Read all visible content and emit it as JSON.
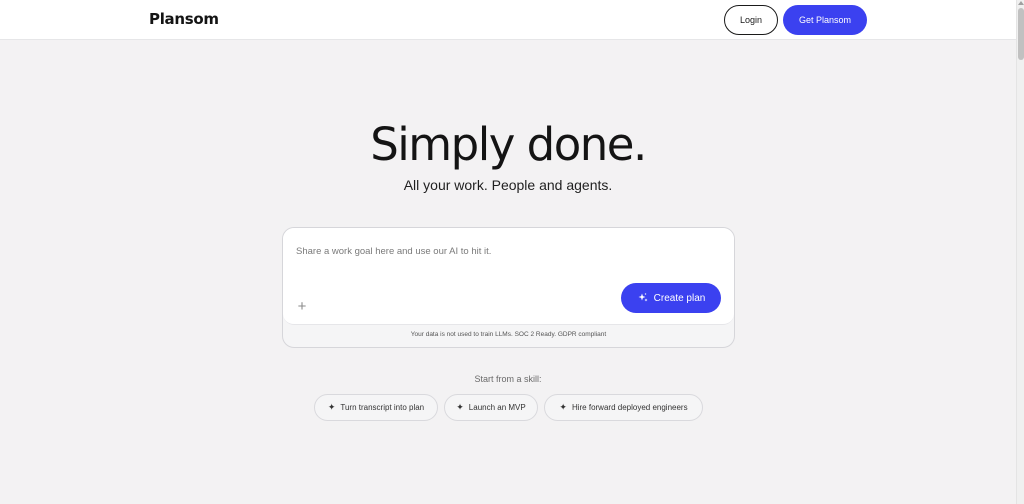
{
  "header": {
    "logo": "Plansom",
    "login_label": "Login",
    "cta_label": "Get Plansom"
  },
  "hero": {
    "title": "Simply done.",
    "subtitle": "All your work. People and agents."
  },
  "prompt": {
    "placeholder": "Share a work goal here and use our AI to hit it.",
    "value": "",
    "attach_icon": "plus-icon",
    "create_label": "Create plan",
    "create_icon": "sparkles-icon",
    "privacy_note": "Your data is not used to train LLMs. SOC 2 Ready. GDPR compliant"
  },
  "skills": {
    "label": "Start from a skill:",
    "items": [
      {
        "label": "Turn transcript into plan",
        "icon": "sparkle-icon"
      },
      {
        "label": "Launch an MVP",
        "icon": "sparkle-icon"
      },
      {
        "label": "Hire forward deployed engineers",
        "icon": "sparkle-icon"
      }
    ]
  },
  "colors": {
    "accent": "#3b41f0",
    "background": "#f3f2f3",
    "text": "#141414"
  }
}
